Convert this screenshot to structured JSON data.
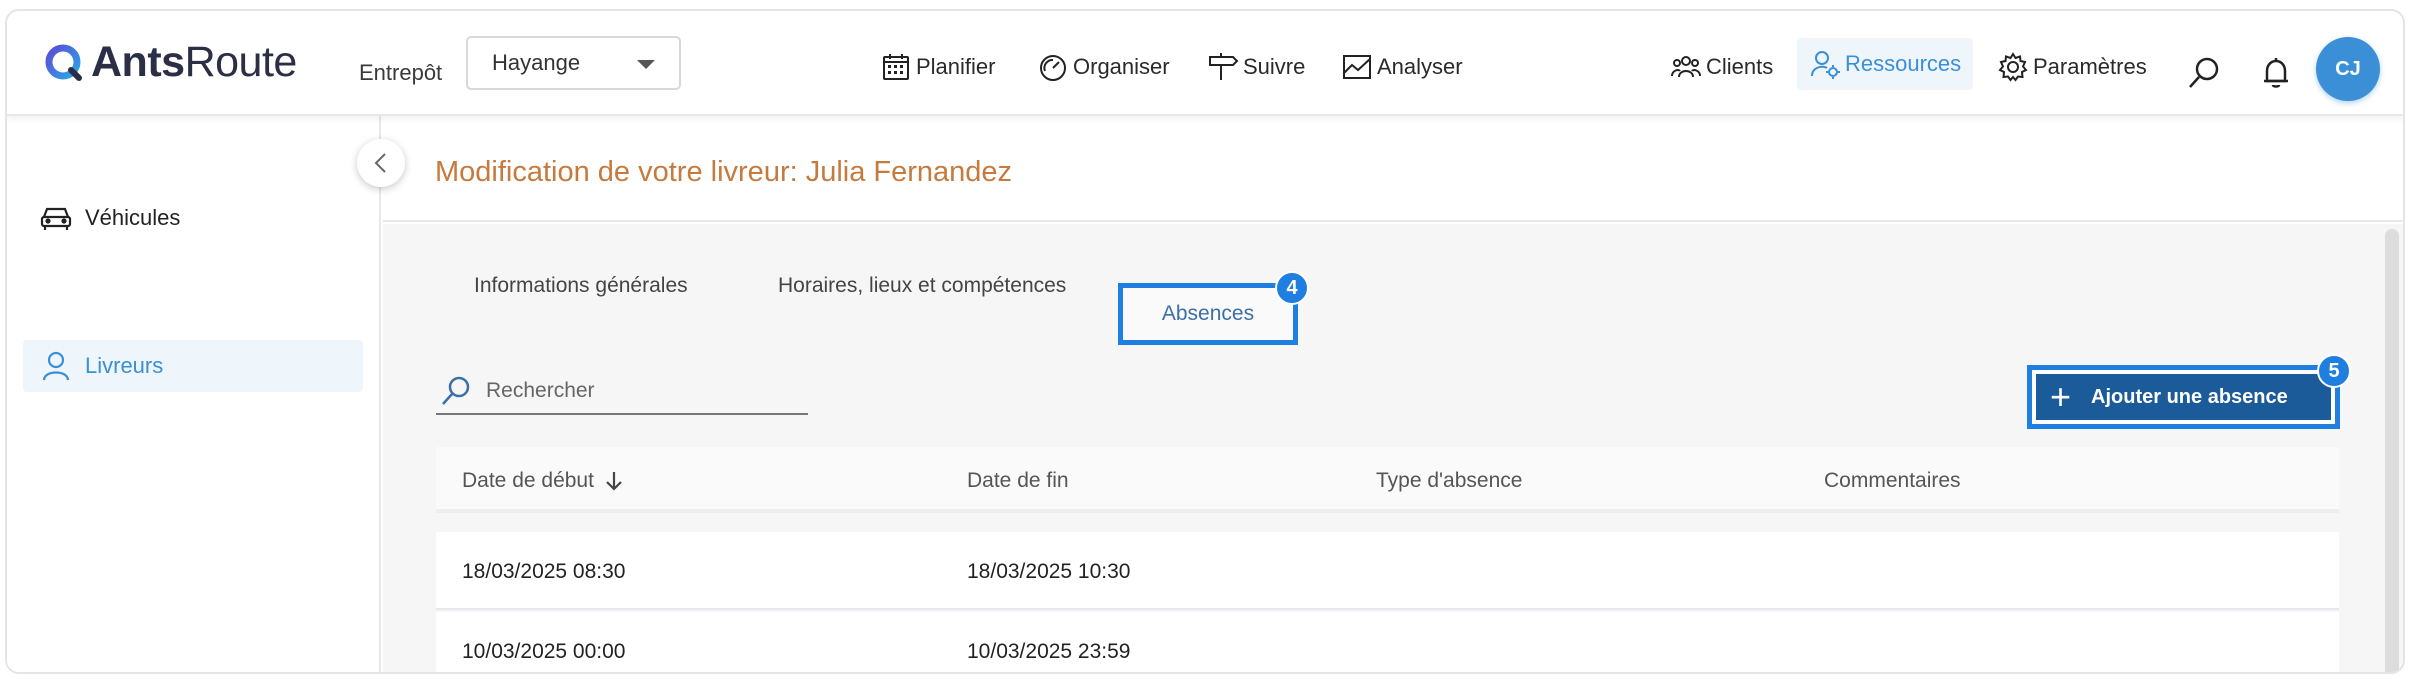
{
  "app": {
    "logo_bold": "Ants",
    "logo_light": "Route"
  },
  "header": {
    "entrepot_label": "Entrepôt",
    "entrepot_value": "Hayange",
    "nav": [
      {
        "label": "Planifier",
        "icon": "calendar-icon"
      },
      {
        "label": "Organiser",
        "icon": "gauge-icon"
      },
      {
        "label": "Suivre",
        "icon": "signpost-icon"
      },
      {
        "label": "Analyser",
        "icon": "chart-icon"
      },
      {
        "label": "Clients",
        "icon": "users-icon"
      },
      {
        "label": "Ressources",
        "icon": "user-gear-icon",
        "active": true
      },
      {
        "label": "Paramètres",
        "icon": "gear-icon"
      }
    ],
    "avatar_initials": "CJ"
  },
  "sidebar": {
    "items": [
      {
        "label": "Véhicules",
        "icon": "car-icon"
      },
      {
        "label": "Livreurs",
        "icon": "user-icon",
        "active": true
      }
    ]
  },
  "main": {
    "title": "Modification de votre livreur: Julia Fernandez",
    "tabs": [
      {
        "label": "Informations générales"
      },
      {
        "label": "Horaires, lieux et compétences"
      },
      {
        "label": "Absences",
        "active": true
      }
    ],
    "badges": {
      "tab": "4",
      "add_button": "5"
    },
    "search": {
      "placeholder": "Rechercher",
      "value": ""
    },
    "add_button_label": "Ajouter une absence",
    "table": {
      "columns": [
        "Date de début",
        "Date de fin",
        "Type d'absence",
        "Commentaires"
      ],
      "rows": [
        {
          "start": "18/03/2025 08:30",
          "end": "18/03/2025 10:30",
          "type": "",
          "comment": ""
        },
        {
          "start": "10/03/2025 00:00",
          "end": "10/03/2025 23:59",
          "type": "",
          "comment": ""
        }
      ]
    }
  },
  "colors": {
    "accent": "#1f7fe0",
    "primary": "#3b8fd6",
    "title": "#c67a3e",
    "button": "#1c5b9a"
  }
}
